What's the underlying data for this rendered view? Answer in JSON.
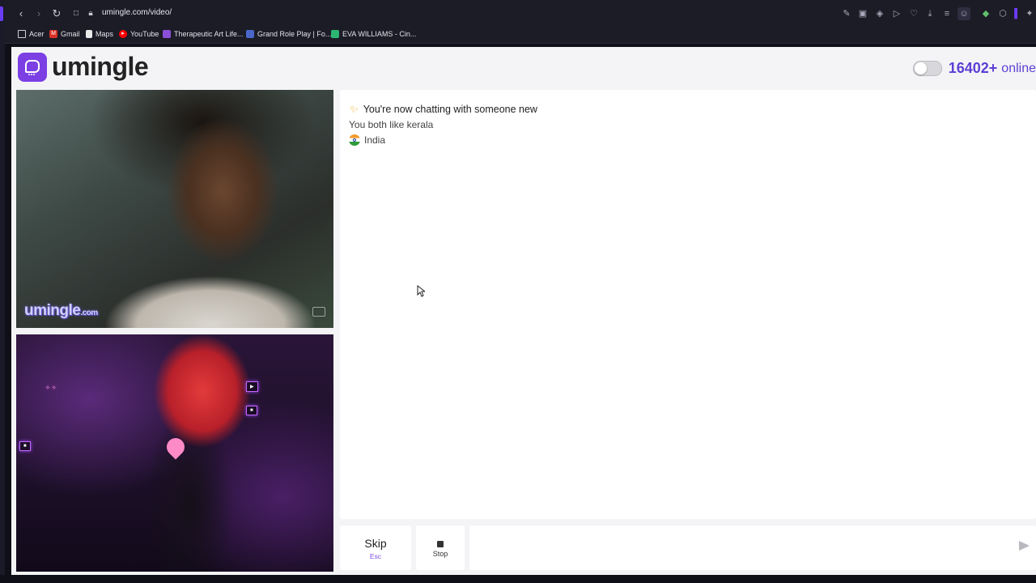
{
  "browser": {
    "url": "umingle.com/video/",
    "bookmarks": [
      {
        "label": "Acer",
        "icon": "folder-icon"
      },
      {
        "label": "Gmail",
        "icon": "gmail-icon"
      },
      {
        "label": "Maps",
        "icon": "maps-icon"
      },
      {
        "label": "YouTube",
        "icon": "youtube-icon"
      },
      {
        "label": "Therapeutic Art Life...",
        "icon": "bookmark-icon"
      },
      {
        "label": "Grand Role Play | Fo...",
        "icon": "bookmark-icon"
      },
      {
        "label": "EVA WILLIAMS - Cin...",
        "icon": "bookmark-icon"
      }
    ]
  },
  "header": {
    "logo_text": "umingle",
    "online_count": "16402+",
    "online_label": "online",
    "theme_toggle_on": false
  },
  "video": {
    "watermark": "umingle",
    "watermark_suffix": ".com"
  },
  "chat": {
    "title": "You're now chatting with someone new",
    "shared_interest": "You both like kerala",
    "country": "India"
  },
  "controls": {
    "skip_label": "Skip",
    "skip_hint": "Esc",
    "stop_label": "Stop",
    "message_placeholder": ""
  },
  "colors": {
    "brand": "#7b3fe4",
    "online_accent": "#5d3fd3",
    "skip_hint": "#7a4de0"
  }
}
